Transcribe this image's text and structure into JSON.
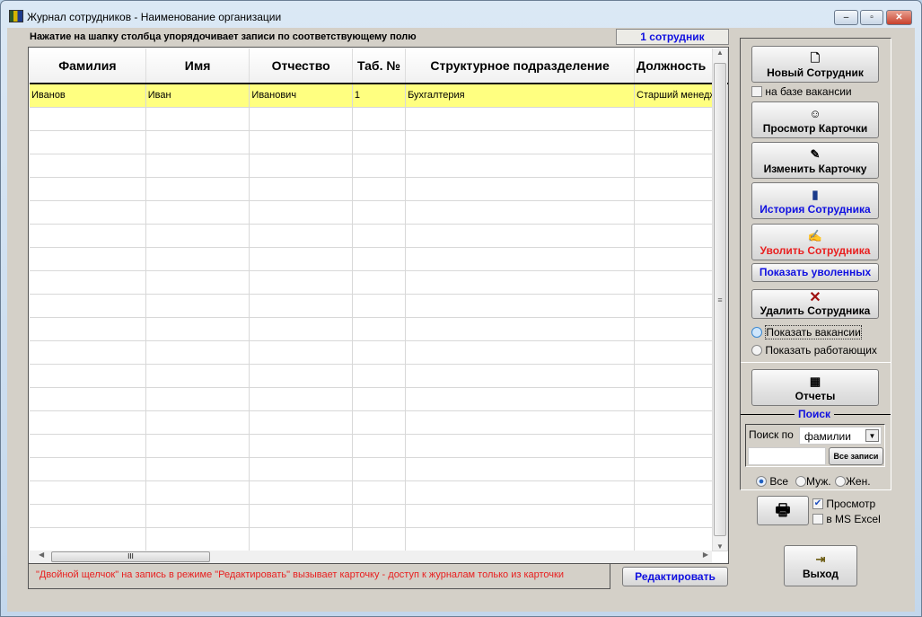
{
  "window": {
    "title": "Журнал сотрудников -  Наименование организации",
    "minimize": "‒",
    "maximize": "▫",
    "close": "✕"
  },
  "hint": "Нажатие на шапку столбца упорядочивает записи  по соответствующему полю",
  "count": "1 сотрудник",
  "table": {
    "columns": [
      "Фамилия",
      "Имя",
      "Отчество",
      "Таб. №",
      "Структурное подразделение",
      "Должность"
    ],
    "rows": [
      [
        "Иванов",
        "Иван",
        "Иванович",
        "1",
        "Бухгалтерия",
        "Старший менеджер"
      ]
    ]
  },
  "footer": {
    "note": "\"Двойной щелчок\" на запись в режиме \"Редактировать\" вызывает карточку  -  доступ к журналам только из карточки",
    "edit": "Редактировать"
  },
  "panel": {
    "new_employee": "Новый Сотрудник",
    "from_vacancy": "на базе вакансии",
    "view_card": "Просмотр Карточки",
    "edit_card": "Изменить Карточку",
    "history": "История Сотрудника",
    "dismiss": "Уволить Сотрудника",
    "show_dismissed": "Показать уволенных",
    "delete": "Удалить Сотрудника",
    "show_vacancies": "Показать вакансии",
    "show_working": "Показать работающих",
    "reports": "Отчеты",
    "search_title": "Поиск",
    "search_by": "Поиск по",
    "search_field": "фамилии",
    "search_value": "",
    "all_records": "Все записи",
    "gender_all": "Все",
    "gender_male": "Муж.",
    "gender_female": "Жен.",
    "preview": "Просмотр",
    "preview_checked": true,
    "excel": "в MS Excel",
    "excel_checked": false,
    "exit": "Выход"
  },
  "colors": {
    "selected_row": "#ffff80",
    "blue_text": "#1010e0",
    "red_text": "#e82020"
  }
}
